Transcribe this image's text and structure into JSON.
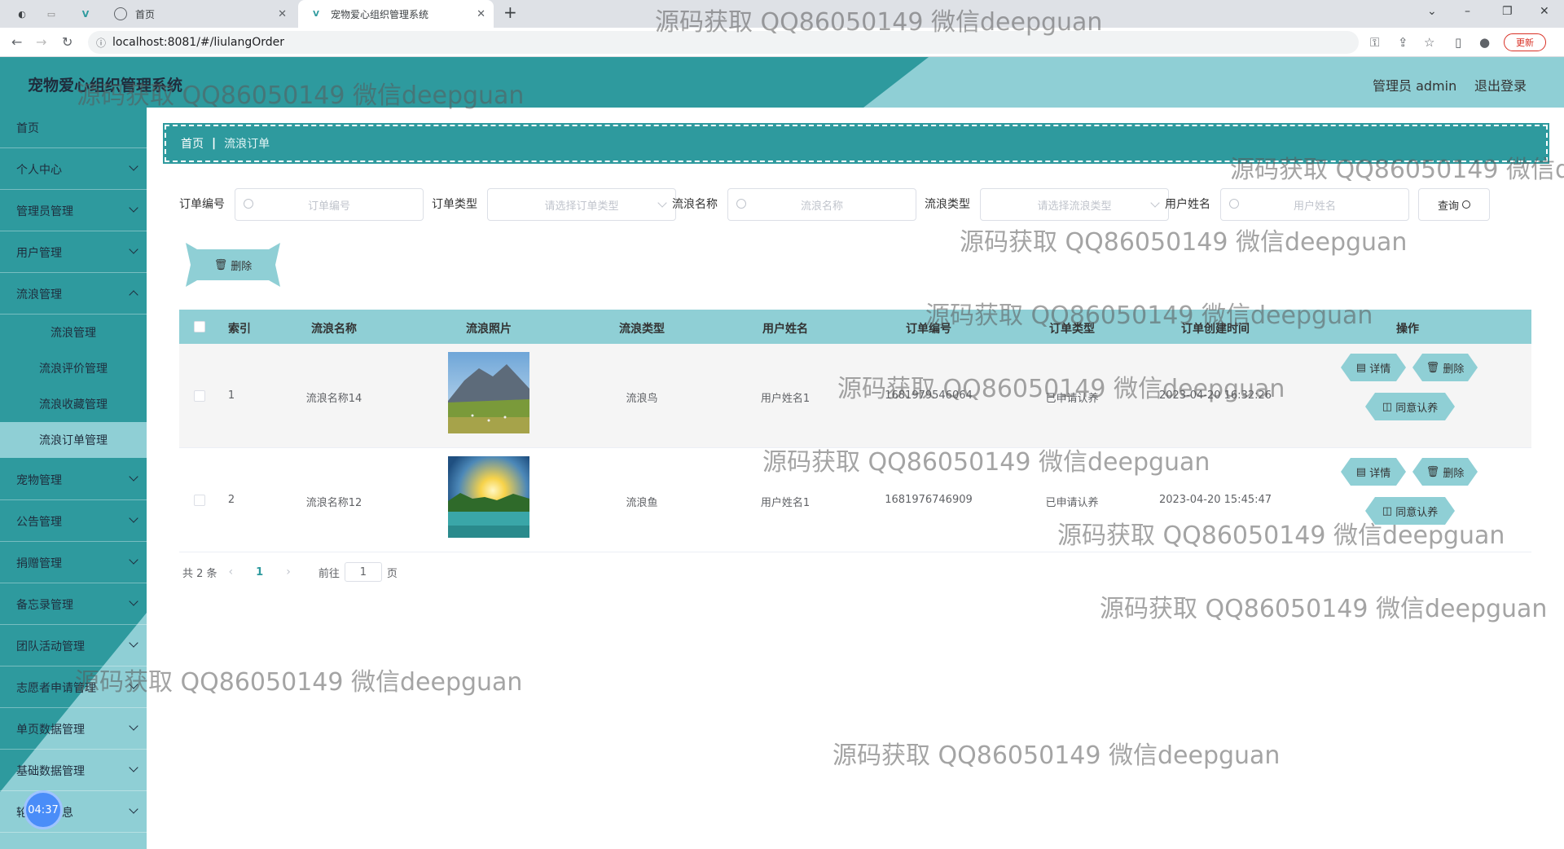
{
  "browser": {
    "tabs": [
      {
        "title": "首页"
      },
      {
        "title": "宠物爱心组织管理系统"
      }
    ],
    "url": "localhost:8081/#/liulangOrder",
    "update_label": "更新"
  },
  "header": {
    "title": "宠物爱心组织管理系统",
    "admin": "管理员 admin",
    "logout": "退出登录"
  },
  "sidebar": {
    "items": [
      {
        "label": "首页"
      },
      {
        "label": "个人中心"
      },
      {
        "label": "管理员管理"
      },
      {
        "label": "用户管理"
      },
      {
        "label": "流浪管理"
      },
      {
        "label": "宠物管理"
      },
      {
        "label": "公告管理"
      },
      {
        "label": "捐赠管理"
      },
      {
        "label": "备忘录管理"
      },
      {
        "label": "团队活动管理"
      },
      {
        "label": "志愿者申请管理"
      },
      {
        "label": "单页数据管理"
      },
      {
        "label": "基础数据管理"
      },
      {
        "label": "轮播图信息"
      }
    ],
    "subitems": [
      {
        "label": "流浪管理"
      },
      {
        "label": "流浪评价管理"
      },
      {
        "label": "流浪收藏管理"
      },
      {
        "label": "流浪订单管理"
      }
    ],
    "clock": "04:37"
  },
  "breadcrumb": {
    "home": "首页",
    "current": "流浪订单"
  },
  "search": {
    "order_no_label": "订单编号",
    "order_no_ph": "订单编号",
    "order_type_label": "订单类型",
    "order_type_ph": "请选择订单类型",
    "name_label": "流浪名称",
    "name_ph": "流浪名称",
    "type_label": "流浪类型",
    "type_ph": "请选择流浪类型",
    "user_label": "用户姓名",
    "user_ph": "用户姓名",
    "query": "查询"
  },
  "toolbar": {
    "delete": "删除"
  },
  "table": {
    "headers": [
      "索引",
      "流浪名称",
      "流浪照片",
      "流浪类型",
      "用户姓名",
      "订单编号",
      "订单类型",
      "订单创建时间",
      "操作"
    ],
    "rows": [
      {
        "index": "1",
        "name": "流浪名称14",
        "type": "流浪鸟",
        "user": "用户姓名1",
        "order_no": "1681979546064",
        "order_type": "已申请认养",
        "time": "2023-04-20 16:32:26"
      },
      {
        "index": "2",
        "name": "流浪名称12",
        "type": "流浪鱼",
        "user": "用户姓名1",
        "order_no": "1681976746909",
        "order_type": "已申请认养",
        "time": "2023-04-20 15:45:47"
      }
    ],
    "ops": {
      "detail": "详情",
      "delete": "删除",
      "agree": "同意认养"
    }
  },
  "pager": {
    "total": "共 2 条",
    "current": "1",
    "goto": "前往",
    "page_value": "1",
    "page_unit": "页"
  },
  "watermark": "源码获取 QQ86050149 微信deepguan",
  "watermark_cut": "源码获取 QQ86050149 微信d"
}
